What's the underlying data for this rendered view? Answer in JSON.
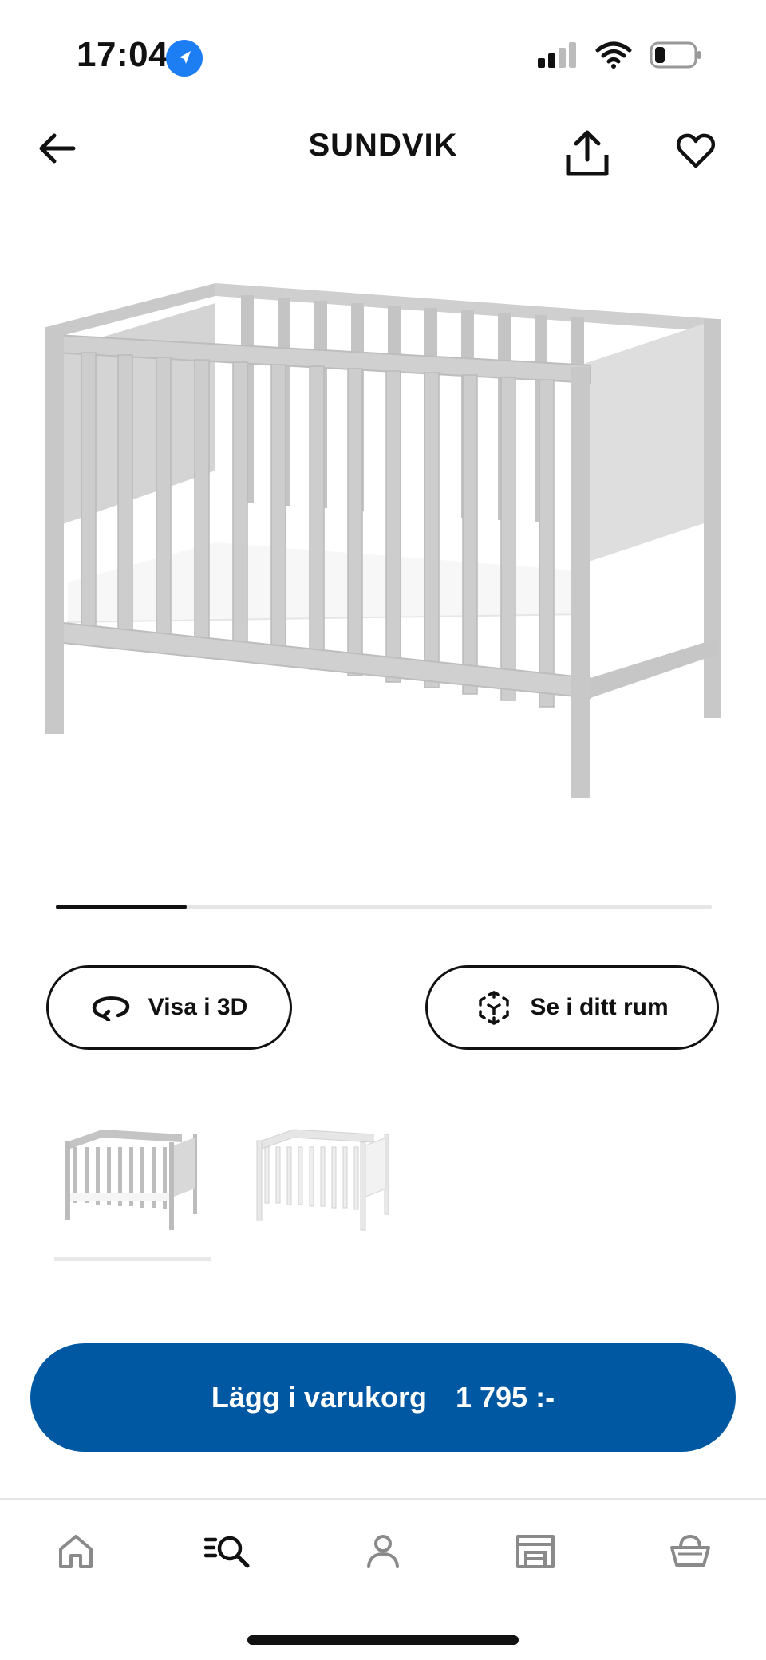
{
  "status_bar": {
    "time": "17:04",
    "icons": [
      "location-arrow-icon",
      "signal-icon",
      "wifi-icon",
      "battery-icon"
    ]
  },
  "header": {
    "title": "SUNDVIK",
    "icons": [
      "back-arrow-icon",
      "share-icon",
      "heart-icon"
    ]
  },
  "gallery": {
    "progress": 0.2,
    "image_subject": "crib"
  },
  "actions": {
    "view_3d_label": "Visa i 3D",
    "view_room_label": "Se i ditt rum"
  },
  "variants": [
    {
      "color": "#bdbdbd",
      "selected": true
    },
    {
      "color": "#f4f4f4",
      "selected": false
    }
  ],
  "cta": {
    "label": "Lägg i varukorg",
    "price": "1 795 :-",
    "color": "#0058a3"
  },
  "bottom_nav": {
    "items": [
      "home-icon",
      "search-icon",
      "profile-icon",
      "store-icon",
      "basket-icon"
    ],
    "active_index": 1
  }
}
